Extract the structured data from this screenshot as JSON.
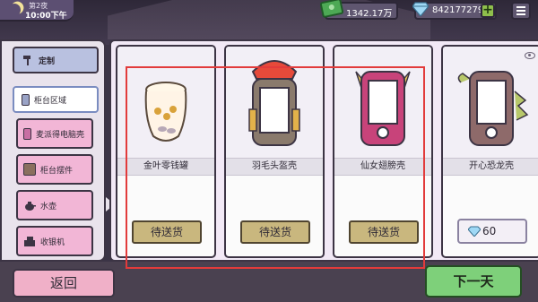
{
  "hud": {
    "day": "第2夜",
    "time": "10:00下午",
    "money": "1342.17万",
    "gems": "842177279",
    "add_label": "+"
  },
  "sidebar": {
    "custom": "定制",
    "counter_area": "柜台区域",
    "items": [
      "麦派得电脑壳",
      "柜台摆件",
      "水壶",
      "收银机"
    ]
  },
  "products": [
    {
      "name": "金叶零钱罐",
      "action": "待送货"
    },
    {
      "name": "羽毛头盔壳",
      "action": "待送货"
    },
    {
      "name": "仙女翅膀壳",
      "action": "待送货"
    },
    {
      "name": "开心恐龙壳",
      "price": "60"
    }
  ],
  "footer": {
    "back": "返回",
    "next_day": "下一天"
  },
  "colors": {
    "pending_button": "#c9b77e",
    "next_day": "#7ed07a",
    "back": "#f0b0c8",
    "highlight": "#e23b3b"
  }
}
